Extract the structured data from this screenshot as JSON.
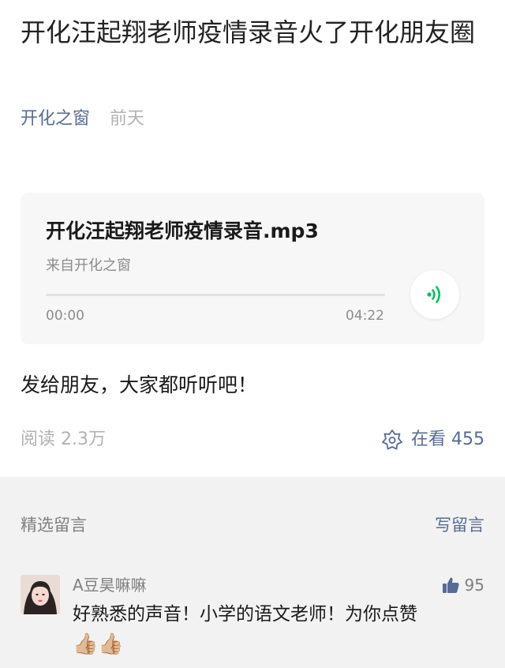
{
  "article": {
    "title": "开化汪起翔老师疫情录音火了开化朋友圈",
    "author": "开化之窗",
    "date": "前天",
    "body": "发给朋友，大家都听听吧！",
    "reads": "阅读 2.3万",
    "watching": "在看 455"
  },
  "audio": {
    "title": "开化汪起翔老师疫情录音.mp3",
    "source": "来自开化之窗",
    "current_time": "00:00",
    "total_time": "04:22",
    "progress": 0
  },
  "comments": {
    "label": "精选留言",
    "write": "写留言",
    "items": [
      {
        "name": "A豆昊嘛嘛",
        "likes": "95",
        "text": "好熟悉的声音！小学的语文老师！为你点赞",
        "emoji": "👍🏼👍🏼"
      }
    ]
  },
  "colors": {
    "link": "#576b95",
    "accent": "#07c160",
    "muted": "#b2b2b2"
  },
  "icons": [
    "audio-wave-icon",
    "watching-icon",
    "thumbs-up-icon"
  ]
}
